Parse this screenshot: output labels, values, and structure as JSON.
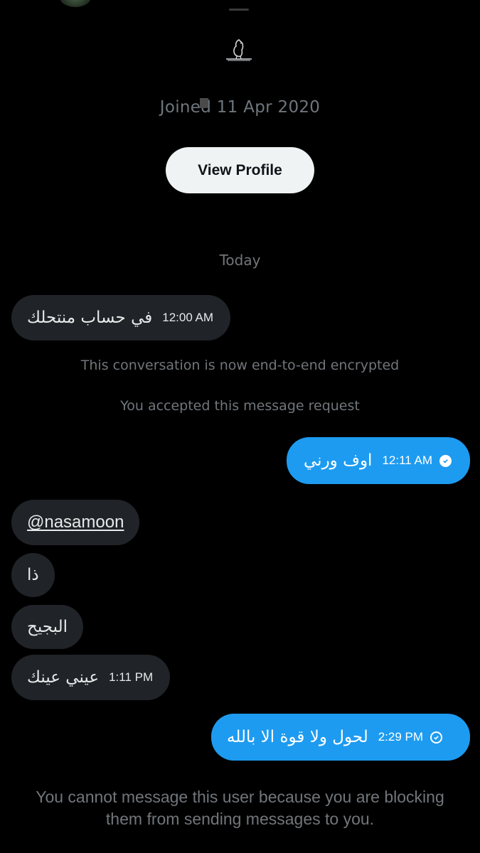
{
  "profile": {
    "joined_text": "Joined 11 Apr 2020",
    "view_profile_label": "View Profile"
  },
  "conversation": {
    "date_separator": "Today",
    "system_encrypted": "This conversation is now end-to-end encrypted",
    "system_accepted": "You accepted this message request",
    "messages": [
      {
        "direction": "in",
        "text": "في حساب منتحلك",
        "time": "12:00 AM"
      },
      {
        "direction": "out",
        "text": "اوف ورني",
        "time": "12:11 AM",
        "status": "read"
      },
      {
        "direction": "in",
        "text": "@nasamoon"
      },
      {
        "direction": "in",
        "text": "ذا"
      },
      {
        "direction": "in",
        "text": "البجيح"
      },
      {
        "direction": "in",
        "text": "عيني عينك",
        "time": "1:11 PM"
      },
      {
        "direction": "out",
        "text": "لحول ولا قوة الا بالله",
        "time": "2:29 PM",
        "status": "sent"
      }
    ],
    "blocked_notice": "You cannot message this user because you are blocking them from sending messages to you."
  },
  "colors": {
    "background": "#000000",
    "incoming_bubble": "#202327",
    "outgoing_bubble": "#1d9bf0",
    "muted_text": "#71767b"
  }
}
